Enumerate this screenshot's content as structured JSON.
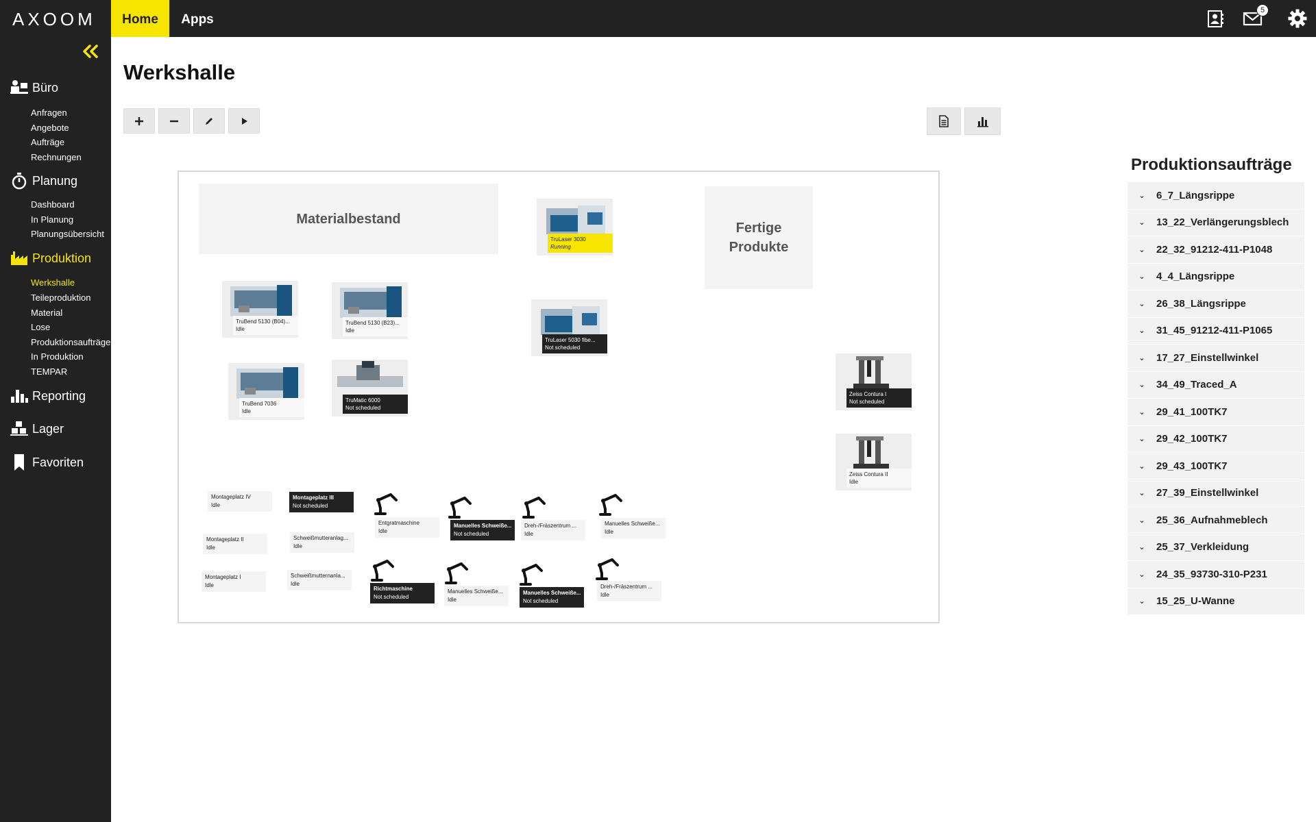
{
  "app": {
    "logo": "AXOOM",
    "nav": [
      {
        "label": "Home"
      },
      {
        "label": "Apps"
      }
    ],
    "mail_count": "5"
  },
  "sidebar": {
    "sections": [
      {
        "label": "Büro",
        "icon": "office-icon",
        "items": [
          "Anfragen",
          "Angebote",
          "Aufträge",
          "Rechnungen"
        ]
      },
      {
        "label": "Planung",
        "icon": "stopwatch-icon",
        "items": [
          "Dashboard",
          "In Planung",
          "Planungsübersicht"
        ]
      },
      {
        "label": "Produktion",
        "icon": "factory-icon",
        "items": [
          "Werkshalle",
          "Teileproduktion",
          "Material",
          "Lose",
          "Produktionsaufträge",
          "In Produktion",
          "TEMPAR"
        ]
      },
      {
        "label": "Reporting",
        "icon": "bar-chart-icon",
        "items": []
      },
      {
        "label": "Lager",
        "icon": "boxes-icon",
        "items": []
      },
      {
        "label": "Favoriten",
        "icon": "bookmark-icon",
        "items": []
      }
    ]
  },
  "page": {
    "title": "Werkshalle"
  },
  "floor": {
    "zones": [
      {
        "label": "Materialbestand"
      },
      {
        "label": "Fertige Produkte"
      }
    ],
    "machines": [
      {
        "name": "TruLaser 3030",
        "status": "Running"
      },
      {
        "name": "TruBend 5130 (B04)...",
        "status": "Idle"
      },
      {
        "name": "TruBend 5130 (B23)...",
        "status": "Idle"
      },
      {
        "name": "TruLaser 5030 fibe...",
        "status": "Not scheduled"
      },
      {
        "name": "TruBend 7036",
        "status": "Idle"
      },
      {
        "name": "TruMatic 6000",
        "status": "Not scheduled"
      },
      {
        "name": "Zeiss Contura I",
        "status": "Not scheduled"
      },
      {
        "name": "Zeiss Contura II",
        "status": "Idle"
      }
    ],
    "stations": [
      {
        "name": "Montageplatz IV",
        "status": "Idle"
      },
      {
        "name": "Montageplatz III",
        "status": "Not scheduled"
      },
      {
        "name": "Entgratmaschine",
        "status": "Idle"
      },
      {
        "name": "Manuelles Schweiße...",
        "status": "Not scheduled"
      },
      {
        "name": "Dreh-/Fräszentrum ...",
        "status": "Idle"
      },
      {
        "name": "Manuelles Schweiße...",
        "status": "Idle"
      },
      {
        "name": "Montageplatz II",
        "status": "Idle"
      },
      {
        "name": "Schweißmutteranlag...",
        "status": "Idle"
      },
      {
        "name": "Montageplatz I",
        "status": "Idle"
      },
      {
        "name": "Schweißmutternanla...",
        "status": "Idle"
      },
      {
        "name": "Richtmaschine",
        "status": "Not scheduled"
      },
      {
        "name": "Manuelles Schweiße...",
        "status": "Idle"
      },
      {
        "name": "Manuelles Schweiße...",
        "status": "Not scheduled"
      },
      {
        "name": "Dreh-/Fräszentrum ...",
        "status": "Idle"
      }
    ]
  },
  "orders": {
    "title": "Produktionsaufträge",
    "items": [
      "6_7_Längsrippe",
      "13_22_Verlängerungsblech",
      "22_32_91212-411-P1048",
      "4_4_Längsrippe",
      "26_38_Längsrippe",
      "31_45_91212-411-P1065",
      "17_27_Einstellwinkel",
      "34_49_Traced_A",
      "29_41_100TK7",
      "29_42_100TK7",
      "29_43_100TK7",
      "27_39_Einstellwinkel",
      "25_36_Aufnahmeblech",
      "25_37_Verkleidung",
      "24_35_93730-310-P231",
      "15_25_U-Wanne"
    ]
  },
  "colors": {
    "accent": "#f7e500",
    "dark": "#222222"
  }
}
